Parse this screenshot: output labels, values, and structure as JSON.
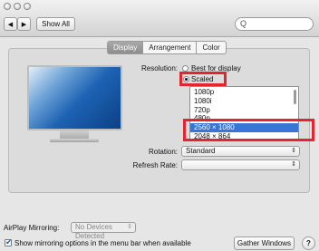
{
  "toolbar": {
    "show_all_label": "Show All",
    "back_glyph": "◀",
    "forward_glyph": "▶",
    "search_placeholder": "",
    "search_glyph": "Q"
  },
  "tabs": [
    {
      "label": "Display",
      "active": true
    },
    {
      "label": "Arrangement",
      "active": false
    },
    {
      "label": "Color",
      "active": false
    }
  ],
  "display": {
    "resolution_label": "Resolution:",
    "resolution_options": [
      {
        "label": "Best for display",
        "selected": false
      },
      {
        "label": "Scaled",
        "selected": true
      }
    ],
    "scaled_list": [
      "1080p",
      "1080i",
      "720p",
      "480p",
      "2560 × 1080",
      "2048 × 864"
    ],
    "scaled_selected": "2560 × 1080",
    "rotation_label": "Rotation:",
    "rotation_value": "Standard",
    "refresh_label": "Refresh Rate:",
    "refresh_value": ""
  },
  "airplay": {
    "label": "AirPlay Mirroring:",
    "value": "No Devices Detected"
  },
  "mirroring_option": {
    "label": "Show mirroring options in the menu bar when available",
    "checked": true
  },
  "gather_label": "Gather Windows",
  "help_label": "?",
  "colors": {
    "selection_blue": "#3875d7",
    "highlight_red": "#e2252e"
  }
}
